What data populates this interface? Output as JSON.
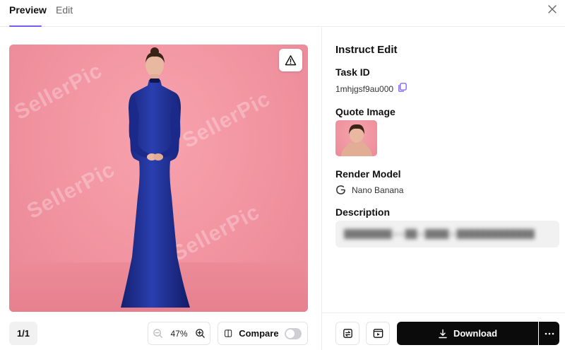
{
  "tabs": {
    "preview": "Preview",
    "edit": "Edit"
  },
  "preview": {
    "watermark": "SellerPic",
    "page_indicator": "1/1",
    "zoom": "47%",
    "compare_label": "Compare",
    "compare_enabled": false
  },
  "details": {
    "title": "Instruct Edit",
    "task_id_label": "Task ID",
    "task_id": "1mhjgsf9au000",
    "quote_image_label": "Quote Image",
    "render_model_label": "Render Model",
    "render_model": "Nano Banana",
    "description_label": "Description",
    "description": "████████ ▪ ▪ ██ ▪ ████ ▪ █████████████"
  },
  "actions": {
    "download_label": "Download"
  },
  "icons": [
    "close-icon",
    "warning-icon",
    "zoom-out-icon",
    "zoom-in-icon",
    "compare-icon",
    "copy-icon",
    "google-icon",
    "swap-image-icon",
    "video-icon",
    "download-icon",
    "more-icon"
  ],
  "colors": {
    "accent": "#7b5cf0",
    "image_background": "#f193a0",
    "dress": "#1a2a8c",
    "download_button": "#0b0b0b"
  }
}
